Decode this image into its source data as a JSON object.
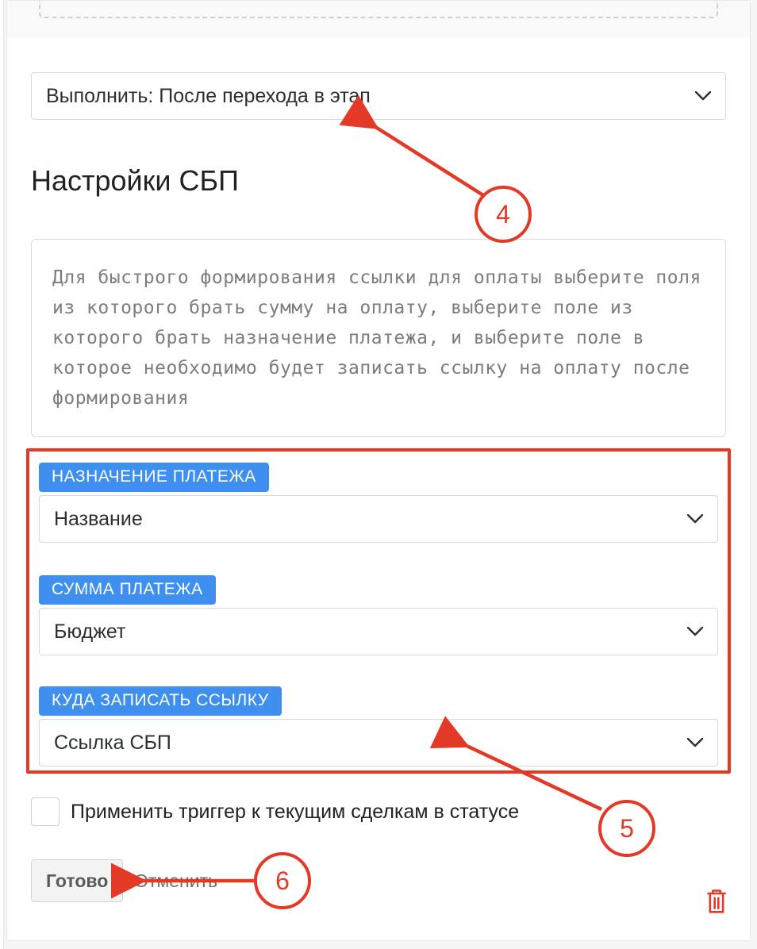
{
  "executeSelect": {
    "label": "Выполнить: После перехода в этап"
  },
  "sectionTitle": "Настройки СБП",
  "helpText": "Для быстрого формирования ссылки для оплаты выберите поля из которого брать сумму на оплату, выберите поле из которого брать назначение платежа, и выберите поле в которое необходимо будет записать ссылку на оплату после формирования",
  "fields": {
    "purpose": {
      "badge": "НАЗНАЧЕНИЕ ПЛАТЕЖА",
      "value": "Название"
    },
    "amount": {
      "badge": "СУММА ПЛАТЕЖА",
      "value": "Бюджет"
    },
    "target": {
      "badge": "КУДА ЗАПИСАТЬ ССЫЛКУ",
      "value": "Ссылка СБП"
    }
  },
  "applyCheckbox": {
    "label": "Применить триггер к текущим сделкам в статусе",
    "checked": false
  },
  "actions": {
    "done": "Готово",
    "cancel": "Отменить"
  },
  "callouts": {
    "c4": "4",
    "c5": "5",
    "c6": "6"
  }
}
